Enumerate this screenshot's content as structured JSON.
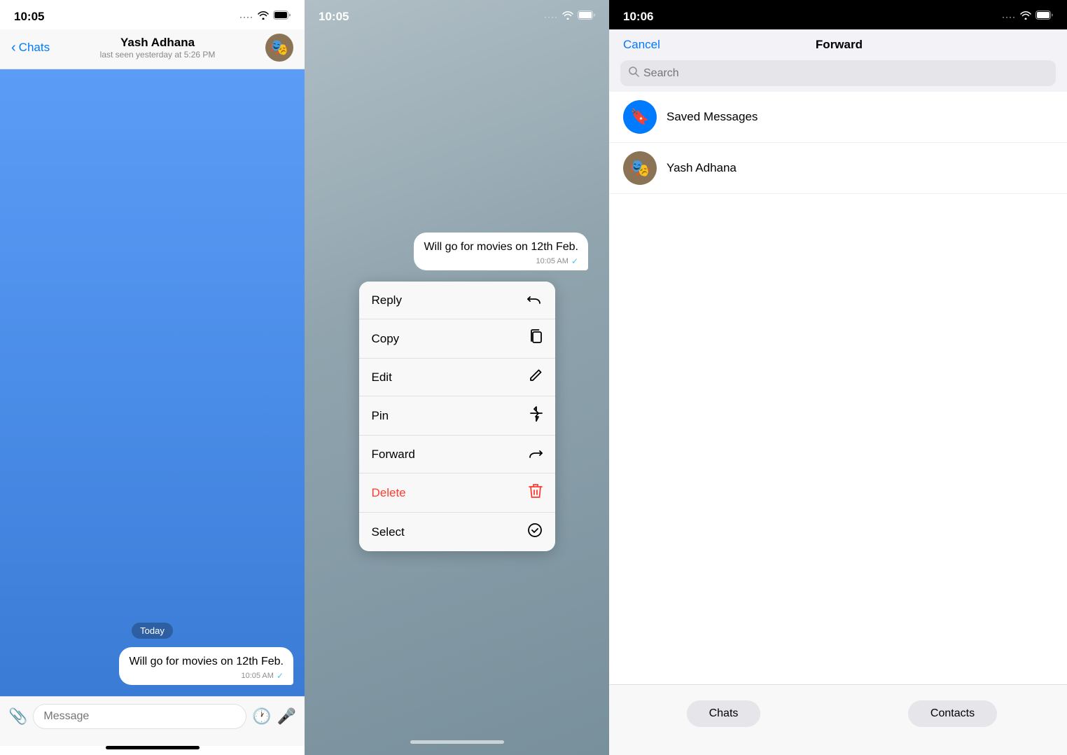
{
  "panel1": {
    "status_bar": {
      "time": "10:05",
      "signal": "····",
      "wifi": "WiFi",
      "battery": "🔋"
    },
    "nav": {
      "back_label": "Chats",
      "contact_name": "Yash Adhana",
      "contact_status": "last seen yesterday at 5:26 PM"
    },
    "chat": {
      "date_separator": "Today",
      "message_text": "Will go for movies on 12th Feb.",
      "message_time": "10:05 AM",
      "input_placeholder": "Message"
    }
  },
  "panel2": {
    "status_bar": {
      "time": "10:05"
    },
    "message_text": "Will go for movies on 12th Feb.",
    "message_time": "10:05 AM",
    "context_menu": {
      "items": [
        {
          "label": "Reply",
          "icon": "↩"
        },
        {
          "label": "Copy",
          "icon": "⎘"
        },
        {
          "label": "Edit",
          "icon": "✏"
        },
        {
          "label": "Pin",
          "icon": "📌"
        },
        {
          "label": "Forward",
          "icon": "↪"
        },
        {
          "label": "Delete",
          "icon": "🗑",
          "is_red": true
        },
        {
          "label": "Select",
          "icon": "✓"
        }
      ]
    }
  },
  "panel3": {
    "status_bar": {
      "time": "10:06"
    },
    "nav": {
      "cancel_label": "Cancel",
      "title": "Forward"
    },
    "search": {
      "placeholder": "Search"
    },
    "list": [
      {
        "name": "Saved Messages",
        "type": "saved"
      },
      {
        "name": "Yash Adhana",
        "type": "user"
      }
    ],
    "tabs": [
      {
        "label": "Chats"
      },
      {
        "label": "Contacts"
      }
    ]
  }
}
